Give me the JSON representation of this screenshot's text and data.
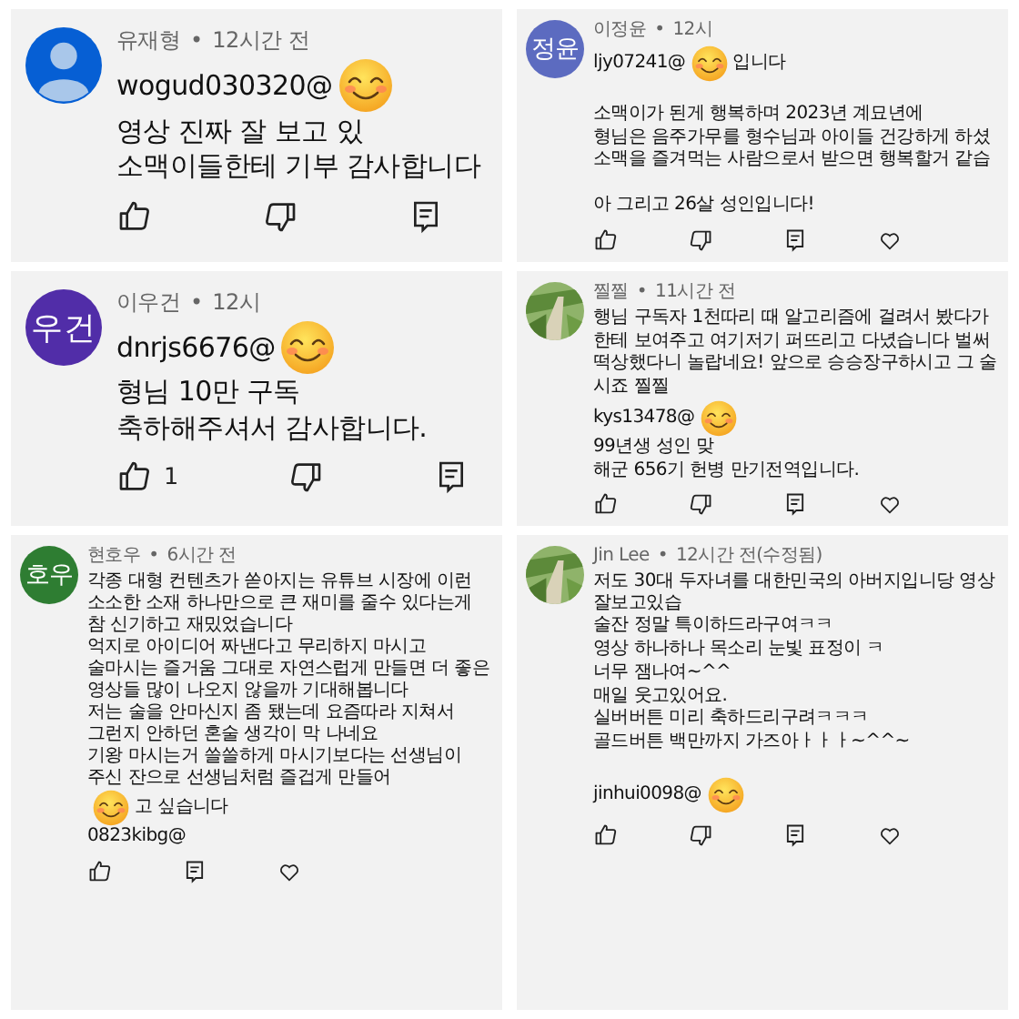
{
  "comments": [
    {
      "avatar": {
        "kind": "default",
        "color": "#065fd4"
      },
      "author": "유재형",
      "separator": "•",
      "time": "12시간 전",
      "paragraphs": [
        [
          [
            {
              "kind": "text",
              "text": "wogud030320@"
            },
            {
              "kind": "sticker"
            }
          ],
          [
            {
              "kind": "text",
              "text": "영상 진짜 잘 보고 있"
            }
          ],
          [
            {
              "kind": "text",
              "text": "소맥이들한테 기부 감사합니다"
            }
          ]
        ]
      ],
      "actions": [
        {
          "kind": "like"
        },
        {
          "kind": "dislike"
        },
        {
          "kind": "reply"
        }
      ]
    },
    {
      "avatar": {
        "kind": "initials",
        "text": "정윤",
        "color": "#5c6bc0"
      },
      "author": "이정윤",
      "separator": "•",
      "time": "12시",
      "paragraphs": [
        [
          [
            {
              "kind": "text",
              "text": "ljy07241@"
            },
            {
              "kind": "sticker"
            },
            {
              "kind": "text",
              "text": "입니다"
            }
          ]
        ],
        [
          [
            {
              "kind": "text",
              "text": "소맥이가 된게 행복하며 2023년 계묘년에"
            }
          ],
          [
            {
              "kind": "text",
              "text": "형님은 음주가무를 형수님과 아이들 건강하게 하셨"
            }
          ],
          [
            {
              "kind": "text",
              "text": "소맥을 즐겨먹는 사람으로서 받으면 행복할거 같습"
            }
          ]
        ],
        [
          [
            {
              "kind": "text",
              "text": "아 그리고 26살 성인입니다!"
            }
          ]
        ]
      ],
      "actions": [
        {
          "kind": "like"
        },
        {
          "kind": "dislike"
        },
        {
          "kind": "reply"
        },
        {
          "kind": "heart"
        }
      ]
    },
    {
      "avatar": {
        "kind": "initials",
        "text": "우건",
        "color": "#512da8"
      },
      "author": "이우건",
      "separator": "•",
      "time": "12시",
      "paragraphs": [
        [
          [
            {
              "kind": "text",
              "text": "dnrjs6676@"
            },
            {
              "kind": "sticker"
            }
          ],
          [
            {
              "kind": "text",
              "text": "형님 10만 구독"
            }
          ],
          [
            {
              "kind": "text",
              "text": "축하해주셔서 감사합니다."
            }
          ]
        ]
      ],
      "actions": [
        {
          "kind": "like",
          "count": "1"
        },
        {
          "kind": "dislike"
        },
        {
          "kind": "reply"
        }
      ]
    },
    {
      "avatar": {
        "kind": "picture"
      },
      "author": "찔찔",
      "separator": "•",
      "time": "11시간 전",
      "paragraphs": [
        [
          [
            {
              "kind": "text",
              "text": "행님 구독자 1천따리 때 알고리즘에 걸려서 봤다가"
            }
          ],
          [
            {
              "kind": "text",
              "text": "한테 보여주고 여기저기 퍼뜨리고 다녔습니다 벌써"
            }
          ],
          [
            {
              "kind": "text",
              "text": "떡상했다니 놀랍네요! 앞으로 승승장구하시고 그 술"
            }
          ],
          [
            {
              "kind": "text",
              "text": "시죠 찔찔"
            }
          ],
          [
            {
              "kind": "text",
              "text": "kys13478@"
            },
            {
              "kind": "sticker"
            }
          ],
          [
            {
              "kind": "text",
              "text": "99년생 성인 맞"
            }
          ],
          [
            {
              "kind": "text",
              "text": "해군 656기 헌병 만기전역입니다."
            }
          ]
        ]
      ],
      "actions": [
        {
          "kind": "like"
        },
        {
          "kind": "dislike"
        },
        {
          "kind": "reply"
        },
        {
          "kind": "heart"
        }
      ]
    },
    {
      "avatar": {
        "kind": "initials",
        "text": "호우",
        "color": "#2e7d32"
      },
      "author": "현호우",
      "separator": "•",
      "time": "6시간 전",
      "paragraphs": [
        [
          [
            {
              "kind": "text",
              "text": "각종 대형 컨텐츠가 쏟아지는 유튜브 시장에 이런 소소한 소재 하나만으로 큰 재미를 줄수 있다는게 참 신기하고 재밌었습니다"
            }
          ],
          [
            {
              "kind": "text",
              "text": "억지로 아이디어 짜낸다고 무리하지 마시고 술마시는 즐거움 그대로 자연스럽게 만들면 더 좋은 영상들 많이 나오지 않을까 기대해봅니다"
            }
          ],
          [
            {
              "kind": "text",
              "text": "저는 술을 안마신지 좀 됐는데 요즘따라 지쳐서 그런지 안하던 혼술 생각이 막 나네요"
            }
          ],
          [
            {
              "kind": "text",
              "text": "기왕 마시는거 쓸쓸하게 마시기보다는 선생님이 주신 잔으로 선생님처럼 즐겁게 만들어"
            },
            {
              "kind": "sticker"
            },
            {
              "kind": "text",
              "text": "고 싶습니다"
            }
          ],
          [
            {
              "kind": "text",
              "text": "0823kibg@"
            }
          ]
        ]
      ],
      "actions": [
        {
          "kind": "like"
        },
        {
          "kind": "reply"
        },
        {
          "kind": "heart"
        }
      ]
    },
    {
      "avatar": {
        "kind": "picture"
      },
      "author": "Jin Lee",
      "separator": "•",
      "time": "12시간 전(수정됨)",
      "paragraphs": [
        [
          [
            {
              "kind": "text",
              "text": "저도 30대 두자녀를 대한민국의 아버지입니당 영상 잘보고있습"
            }
          ],
          [
            {
              "kind": "text",
              "text": "술잔 정말 특이하드라구여ㅋㅋ"
            }
          ],
          [
            {
              "kind": "text",
              "text": "영상 하나하나 목소리 눈빛 표정이 ㅋ"
            }
          ],
          [
            {
              "kind": "text",
              "text": "너무 잼나여~^^"
            }
          ],
          [
            {
              "kind": "text",
              "text": "매일 웃고있어요."
            }
          ],
          [
            {
              "kind": "text",
              "text": "실버버튼 미리 축하드리구려ㅋㅋㅋ"
            }
          ],
          [
            {
              "kind": "text",
              "text": "골드버튼 백만까지 가즈아ㅏㅏㅏ~^^~"
            }
          ]
        ],
        [
          [
            {
              "kind": "text",
              "text": "jinhui0098@"
            },
            {
              "kind": "sticker"
            }
          ]
        ]
      ],
      "actions": [
        {
          "kind": "like"
        },
        {
          "kind": "dislike"
        },
        {
          "kind": "reply"
        },
        {
          "kind": "heart"
        }
      ]
    }
  ]
}
